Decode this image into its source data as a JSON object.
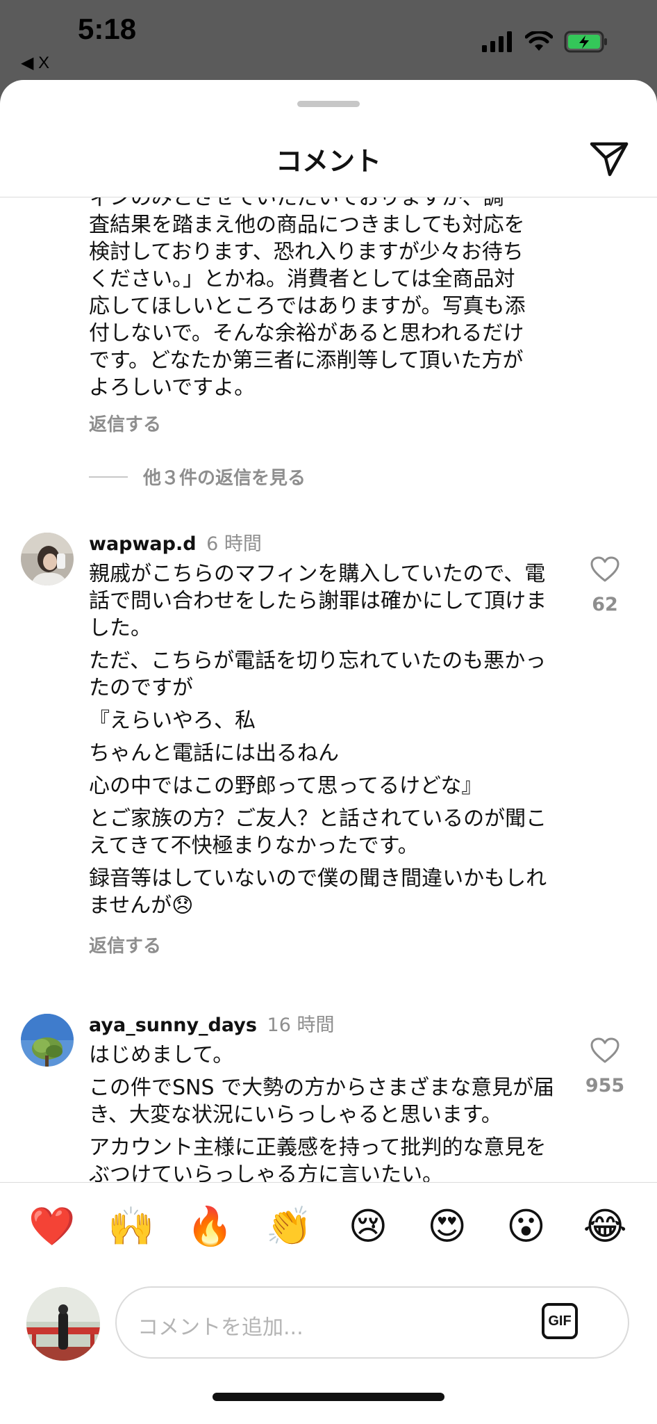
{
  "status_bar": {
    "time": "5:18",
    "back_label": "◀ X"
  },
  "header": {
    "title": "コメント"
  },
  "continued_comment": {
    "text": "ィンのみとさせていただいておりますが、調\n査結果を踏まえ他の商品につきましても対応を\n検討しております、恐れ入りますが少々お待ち\nください。」とかね。消費者としては全商品対\n応してほしいところではありますが。写真も添\n付しないで。そんな余裕があると思われるだけ\nです。どなたか第三者に添削等して頂いた方が\nよろしいですよ。",
    "reply_label": "返信する",
    "view_replies_label": "他３件の返信を見る"
  },
  "comments": [
    {
      "username": "wapwap.d",
      "time": "6 時間",
      "paragraphs": [
        "親戚がこちらのマフィンを購入していたので、電話で問い合わせをしたら謝罪は確かにして頂けました。",
        "ただ、こちらが電話を切り忘れていたのも悪かったのですが",
        "『えらいやろ、私",
        "ちゃんと電話には出るねん",
        "心の中ではこの野郎って思ってるけどな』",
        "とご家族の方？ご友人？と話されているのが聞こえてきて不快極まりなかったです。",
        "録音等はしていないので僕の聞き間違いかもしれませんが😞"
      ],
      "likes": "62",
      "reply_label": "返信する"
    },
    {
      "username": "aya_sunny_days",
      "time": "16 時間",
      "paragraphs": [
        "はじめまして。",
        "この件でSNS で大勢の方からさまざまな意見が届き、大変な状況にいらっしゃると思います。",
        "アカウント主様に正義感を持って批判的な意見をぶつけていらっしゃる方に言いたい。"
      ],
      "likes": "955"
    }
  ],
  "emoji_bar": [
    "❤️",
    "🙌",
    "🔥",
    "👏",
    "😢",
    "😍",
    "😮",
    "😂"
  ],
  "composer": {
    "placeholder": "コメントを追加...",
    "gif_label": "GIF"
  },
  "colors": {
    "status_bar_bg": "#5b5b5b",
    "battery_green": "#34c759",
    "secondary_text": "#8e8e8e",
    "divider": "#dbdbdb"
  },
  "icons": {
    "share": "paper-plane-icon",
    "like": "heart-outline-icon",
    "signal": "cellular-signal-icon",
    "wifi": "wifi-icon",
    "battery": "battery-charging-icon"
  }
}
